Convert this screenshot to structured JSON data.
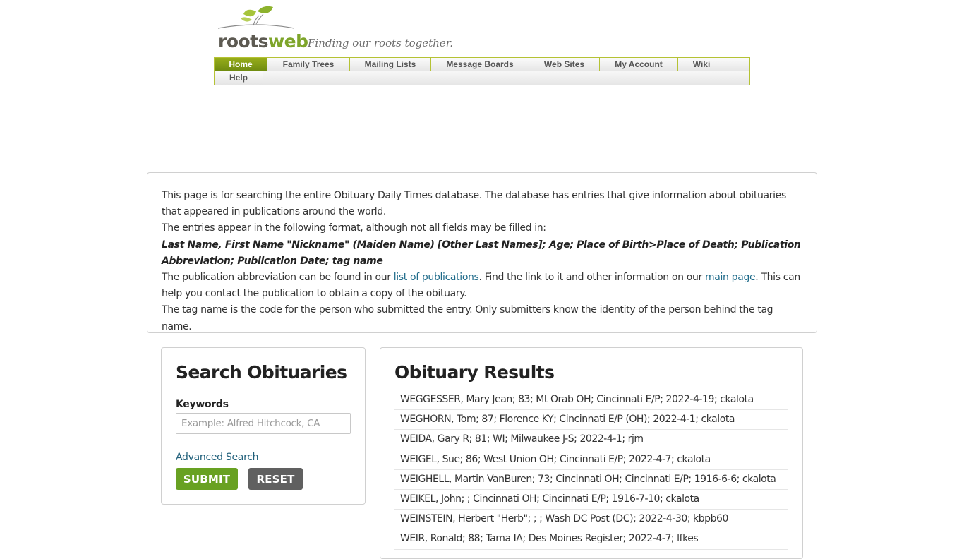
{
  "brand": {
    "logo_part1": "roots",
    "logo_part2": "web",
    "tagline": "Finding our roots together.",
    "colors": {
      "green": "#7ea52b",
      "brown": "#5d5a52",
      "nav_border": "#b5c234"
    }
  },
  "nav": {
    "row1": [
      {
        "label": "Home",
        "active": true
      },
      {
        "label": "Family Trees"
      },
      {
        "label": "Mailing Lists"
      },
      {
        "label": "Message Boards"
      },
      {
        "label": "Web Sites"
      },
      {
        "label": "My Account"
      },
      {
        "label": "Wiki"
      }
    ],
    "row2": [
      {
        "label": "Help"
      }
    ]
  },
  "intro": {
    "line1": "This page is for searching the entire Obituary Daily Times database. The database has entries that give information about obituaries that appeared in publications around the world.",
    "line2": "The entries appear in the following format, although not all fields may be filled in:",
    "format": "Last Name, First Name \"Nickname\" (Maiden Name) [Other Last Names]; Age; Place of Birth>Place of Death; Publication Abbreviation; Publication Date; tag name",
    "line3_a": "The publication abbreviation can be found in our ",
    "line3_link1": "list of publications",
    "line3_b": ". Find the link to it and other information on our ",
    "line3_link2": "main page",
    "line3_c": ". This can help you contact the publication to obtain a copy of the obituary.",
    "line4": "The tag name is the code for the person who submitted the entry. Only submitters know the identity of the person behind the tag name."
  },
  "search": {
    "title": "Search Obituaries",
    "keywords_label": "Keywords",
    "keywords_value": "",
    "keywords_placeholder": "Example: Alfred Hitchcock, CA",
    "advanced_link": "Advanced Search",
    "submit_label": "SUBMIT",
    "reset_label": "RESET",
    "colors": {
      "submit": "#68a122",
      "reset": "#606060"
    }
  },
  "results": {
    "title": "Obituary Results",
    "items": [
      "WEGGESSER, Mary Jean; 83; Mt Orab OH; Cincinnati E/P; 2022-4-19; ckalota",
      "WEGHORN, Tom; 87; Florence KY; Cincinnati E/P (OH); 2022-4-1; ckalota",
      "WEIDA, Gary R; 81; WI; Milwaukee J-S; 2022-4-1; rjm",
      "WEIGEL, Sue; 86; West Union OH; Cincinnati E/P; 2022-4-7; ckalota",
      "WEIGHELL, Martin VanBuren; 73; Cincinnati OH; Cincinnati E/P; 1916-6-6; ckalota",
      "WEIKEL, John; ; Cincinnati OH; Cincinnati E/P; 1916-7-10; ckalota",
      "WEINSTEIN, Herbert \"Herb\"; ; ; Wash DC Post (DC); 2022-4-30; kbpb60",
      "WEIR, Ronald; 88; Tama IA; Des Moines Register; 2022-4-7; lfkes"
    ]
  }
}
